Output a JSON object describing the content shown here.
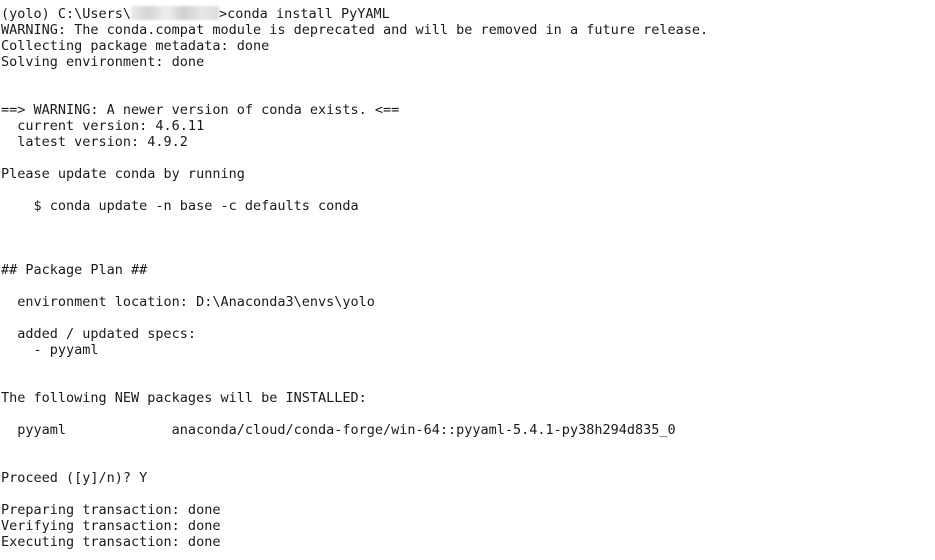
{
  "terminal": {
    "lines": [
      {
        "prefix": "(yolo) C:\\Users\\",
        "redacted": true,
        "suffix": ">conda install PyYAML"
      },
      {
        "text": "WARNING: The conda.compat module is deprecated and will be removed in a future release."
      },
      {
        "text": "Collecting package metadata: done"
      },
      {
        "text": "Solving environment: done"
      },
      {
        "text": ""
      },
      {
        "text": ""
      },
      {
        "text": "==> WARNING: A newer version of conda exists. <=="
      },
      {
        "text": "  current version: 4.6.11"
      },
      {
        "text": "  latest version: 4.9.2"
      },
      {
        "text": ""
      },
      {
        "text": "Please update conda by running"
      },
      {
        "text": ""
      },
      {
        "text": "    $ conda update -n base -c defaults conda"
      },
      {
        "text": ""
      },
      {
        "text": ""
      },
      {
        "text": ""
      },
      {
        "text": "## Package Plan ##"
      },
      {
        "text": ""
      },
      {
        "text": "  environment location: D:\\Anaconda3\\envs\\yolo"
      },
      {
        "text": ""
      },
      {
        "text": "  added / updated specs:"
      },
      {
        "text": "    - pyyaml"
      },
      {
        "text": ""
      },
      {
        "text": ""
      },
      {
        "text": "The following NEW packages will be INSTALLED:"
      },
      {
        "text": ""
      },
      {
        "text": "  pyyaml             anaconda/cloud/conda-forge/win-64::pyyaml-5.4.1-py38h294d835_0"
      },
      {
        "text": ""
      },
      {
        "text": ""
      },
      {
        "text": "Proceed ([y]/n)? Y"
      },
      {
        "text": ""
      },
      {
        "text": "Preparing transaction: done"
      },
      {
        "text": "Verifying transaction: done"
      },
      {
        "text": "Executing transaction: done"
      }
    ]
  }
}
